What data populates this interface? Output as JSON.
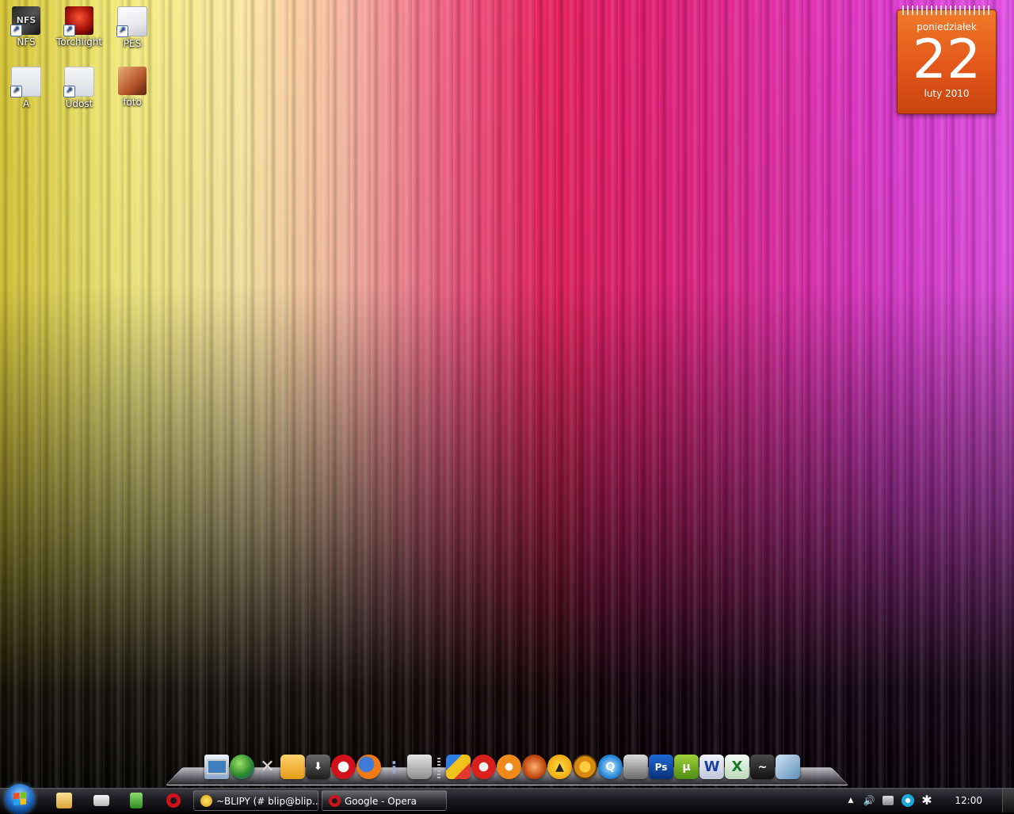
{
  "desktop": {
    "icons": [
      {
        "label": "NFS",
        "icon": "nfs-game-icon"
      },
      {
        "label": "Torchlight",
        "icon": "torchlight-game-icon"
      },
      {
        "label": "PES",
        "icon": "pes-game-icon"
      },
      {
        "label": "A",
        "icon": "folder-icon"
      },
      {
        "label": "Udost",
        "icon": "folder-icon"
      },
      {
        "label": "foto",
        "icon": "photo-folder-icon"
      }
    ]
  },
  "calendar": {
    "weekday": "poniedziałek",
    "day": "22",
    "month_year": "luty 2010"
  },
  "dock": {
    "items": [
      "computer-icon",
      "globe-icon",
      "tools-icon",
      "folder-icon",
      "downloads-icon",
      "opera-icon",
      "firefox-icon",
      "signal-icon",
      "trash-icon",
      "cubes-icon",
      "ccleaner-icon",
      "gom-player-icon",
      "media-icon",
      "aimp-icon",
      "circle-app-icon",
      "quicktime-icon",
      "printer-icon",
      "photoshop-icon",
      "utorrent-icon",
      "word-icon",
      "excel-icon",
      "steam-icon",
      "virtualbox-icon"
    ]
  },
  "taskbar": {
    "buttons": [
      {
        "label": "~BLIPY (# blip@blip....",
        "icon": "chat-icon"
      },
      {
        "label": "Google - Opera",
        "icon": "opera-icon"
      }
    ],
    "clock": "12:00"
  },
  "colors": {
    "calendar_orange": "#e2571a",
    "taskbar_dark": "#1b1b20"
  }
}
